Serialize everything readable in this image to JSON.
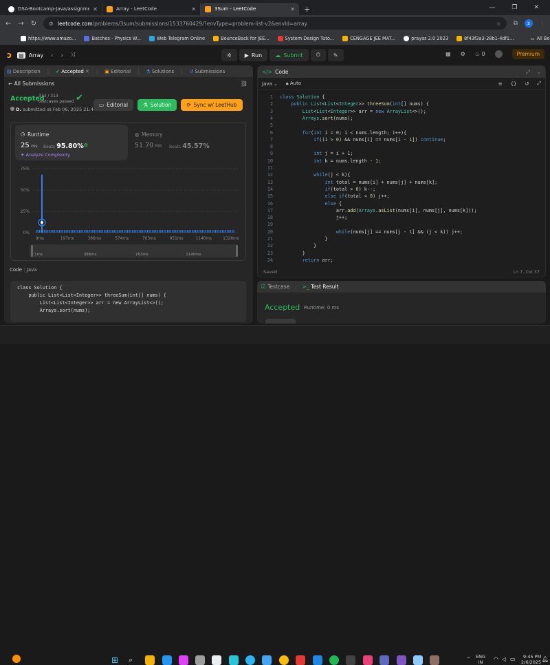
{
  "browser": {
    "tabs": [
      {
        "title": "DSA-Bootcamp-Java/assignme",
        "icon_color": "#ffffff"
      },
      {
        "title": "Array - LeetCode",
        "icon_color": "#ffa116"
      },
      {
        "title": "3Sum - LeetCode",
        "icon_color": "#ffa116"
      }
    ],
    "new_tab": "+",
    "url_domain": "leetcode.com",
    "url_path": "/problems/3sum/submissions/1533760429/?envType=problem-list-v2&envId=array",
    "profile": "s",
    "bookmarks": [
      {
        "label": "https://www.amazo...",
        "color": "#ffffff"
      },
      {
        "label": "Batches - Physics W...",
        "color": "#5b6ee1"
      },
      {
        "label": "Web Telegram Online",
        "color": "#2aa7e0"
      },
      {
        "label": "BounceBack for JEE...",
        "color": "#f4b400"
      },
      {
        "label": "System Design Tuto...",
        "color": "#e53935"
      },
      {
        "label": "CENGAGE JEE MAT...",
        "color": "#f4b400"
      },
      {
        "label": "prayas 2.0 2023",
        "color": "#ffffff"
      },
      {
        "label": "8f43f3a3-28b1-4df1...",
        "color": "#f4b400"
      }
    ],
    "all_bookmarks": "All Bookmarks"
  },
  "lc_header": {
    "problem_list": "Array",
    "run": "Run",
    "submit": "Submit",
    "streak": "0",
    "premium": "Premium"
  },
  "left_panel": {
    "tabs": [
      "Description",
      "Accepted",
      "Editorial",
      "Solutions",
      "Submissions"
    ],
    "all_submissions": "All Submissions",
    "status": "Accepted",
    "testcases_count": "313 / 313",
    "testcases_label": "testcases passed",
    "user": "D.",
    "submitted_at": "submitted at Feb 06, 2025 21:44",
    "editorial_btn": "Editorial",
    "solution_btn": "Solution",
    "sync_btn": "Sync w/ LeetHub",
    "runtime_label": "Runtime",
    "runtime_value": "25",
    "runtime_unit": "ms",
    "runtime_beats_label": "Beats",
    "runtime_beats": "95.80%",
    "analyze": "Analyze Complexity",
    "memory_label": "Memory",
    "memory_value": "51.70",
    "memory_unit": "MB",
    "memory_beats_label": "Beats",
    "memory_beats": "45.57%",
    "code_label": "Code",
    "code_lang": "Java",
    "code_preview": [
      "class Solution {",
      "    public List<List<Integer>> threeSum(int[] nums) {",
      "        List<List<Integer>> arr = new ArrayList<>();",
      "        Arrays.sort(nums);"
    ]
  },
  "chart_data": {
    "type": "bar",
    "y_ticks": [
      "75%",
      "50%",
      "25%",
      "0%"
    ],
    "x_ticks": [
      "9ms",
      "197ms",
      "386ms",
      "574ms",
      "763ms",
      "951ms",
      "1140ms",
      "1328ms"
    ],
    "range_ticks": [
      "1ms",
      "386ms",
      "763ms",
      "1140ms"
    ],
    "ylim": [
      0,
      75
    ],
    "peak": {
      "x": "9ms",
      "y": 68
    },
    "marker": {
      "x": "9ms",
      "y": 12
    },
    "bar_color": "#2f80ed"
  },
  "right_panel": {
    "title": "Code",
    "language": "Java",
    "mode": "Auto",
    "saved": "Saved",
    "cursor": "Ln 7, Col 37",
    "lines": [
      "class Solution {",
      "    public List<List<Integer>> threeSum(int[] nums) {",
      "        List<List<Integer>> arr = new ArrayList<>();",
      "        Arrays.sort(nums);",
      "",
      "        for(int i = 0; i < nums.length; i++){",
      "            if((i > 0) && nums[i] == nums[i - 1]) continue;",
      "",
      "            int j = i + 1;",
      "            int k = nums.length - 1;",
      "",
      "            while(j < k){",
      "                int total = nums[i] + nums[j] + nums[k];",
      "                if(total > 0) k--;",
      "                else if(total < 0) j++;",
      "                else {",
      "                    arr.add(Arrays.asList(nums[i], nums[j], nums[k]));",
      "                    j++;",
      "",
      "                    while(nums[j] == nums[j - 1] && (j < k)) j++;",
      "                }",
      "            }",
      "        }",
      "        return arr;"
    ],
    "line_numbers": [
      "1",
      "2",
      "3",
      "4",
      "5",
      "6",
      "7",
      "8",
      "9",
      "10",
      "11",
      "12",
      "13",
      "14",
      "15",
      "16",
      "17",
      "18",
      "19",
      "20",
      "21",
      "22",
      "23",
      "24"
    ]
  },
  "bottom_panel": {
    "tab_testcase": "Testcase",
    "tab_result": "Test Result",
    "status": "Accepted",
    "runtime": "Runtime: 0 ms"
  },
  "taskbar": {
    "lang": "ENG",
    "region": "IN",
    "time": "9:45 PM",
    "date": "2/6/2025"
  }
}
